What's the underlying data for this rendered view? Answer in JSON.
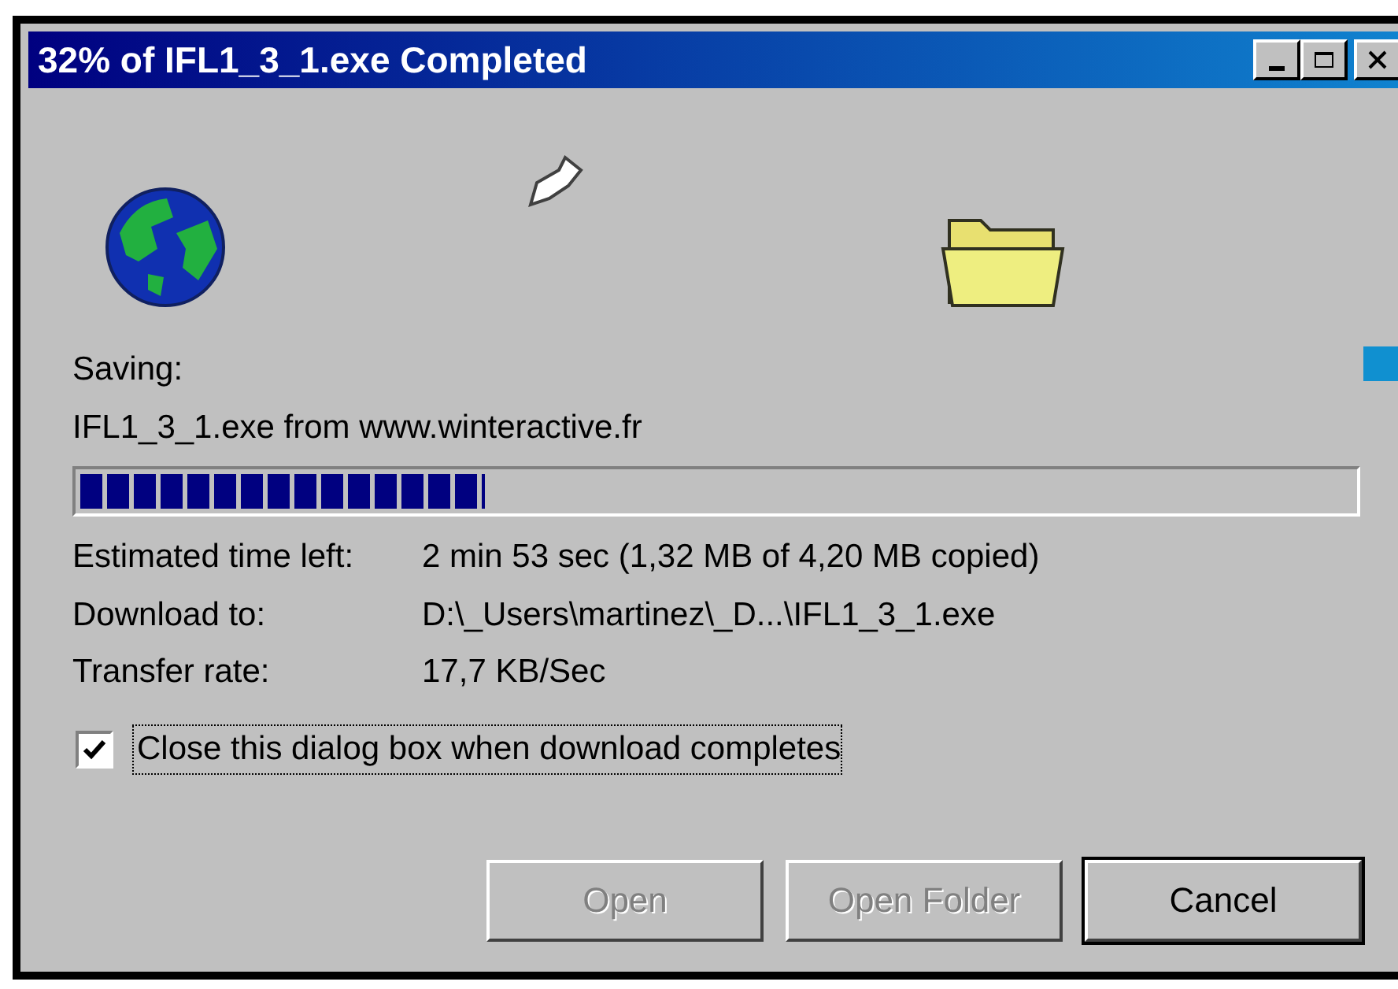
{
  "window": {
    "title": "32% of IFL1_3_1.exe Completed"
  },
  "saving_label": "Saving:",
  "file_line": "IFL1_3_1.exe from www.winteractive.fr",
  "progress": {
    "level": 0.32
  },
  "details": [
    {
      "label": "Estimated time left:",
      "value": "2 min 53 sec (1,32 MB of 4,20 MB copied)"
    },
    {
      "label": "Download to:",
      "value": "D:\\_Users\\martinez\\_D...\\IFL1_3_1.exe"
    },
    {
      "label": "Transfer rate:",
      "value": "17,7 KB/Sec"
    }
  ],
  "close_when_done": {
    "label": "Close this dialog box when download completes",
    "checked": true
  },
  "buttons": [
    {
      "label": "Open",
      "disabled": true
    },
    {
      "label": "Open Folder",
      "disabled": true
    },
    {
      "label": "Cancel",
      "disabled": false
    }
  ]
}
